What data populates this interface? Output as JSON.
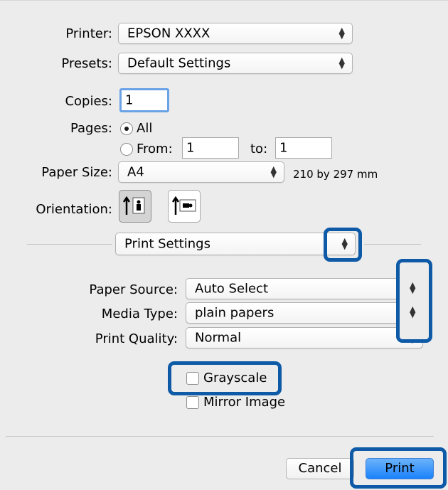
{
  "printer": {
    "label": "Printer:",
    "value": "EPSON XXXX"
  },
  "presets": {
    "label": "Presets:",
    "value": "Default Settings"
  },
  "copies": {
    "label": "Copies:",
    "value": "1"
  },
  "pages": {
    "label": "Pages:",
    "all_label": "All",
    "from_label": "From:",
    "from_value": "1",
    "to_label": "to:",
    "to_value": "1",
    "selected": "all"
  },
  "paper_size": {
    "label": "Paper Size:",
    "value": "A4",
    "dimensions": "210 by 297 mm"
  },
  "orientation": {
    "label": "Orientation:",
    "selected": "portrait"
  },
  "section_popup": {
    "value": "Print Settings"
  },
  "paper_source": {
    "label": "Paper Source:",
    "value": "Auto Select"
  },
  "media_type": {
    "label": "Media Type:",
    "value": "plain papers"
  },
  "print_quality": {
    "label": "Print Quality:",
    "value": "Normal"
  },
  "grayscale": {
    "label": "Grayscale",
    "checked": false
  },
  "mirror_image": {
    "label": "Mirror Image",
    "checked": false
  },
  "buttons": {
    "cancel": "Cancel",
    "print": "Print"
  },
  "colors": {
    "highlight": "#0e5aa7",
    "print_button": "#1a82fb",
    "background": "#ececec"
  },
  "icons": {
    "popup_arrows": "up-down-chevron-icon",
    "portrait": "portrait-orientation-icon",
    "landscape": "landscape-orientation-icon"
  }
}
